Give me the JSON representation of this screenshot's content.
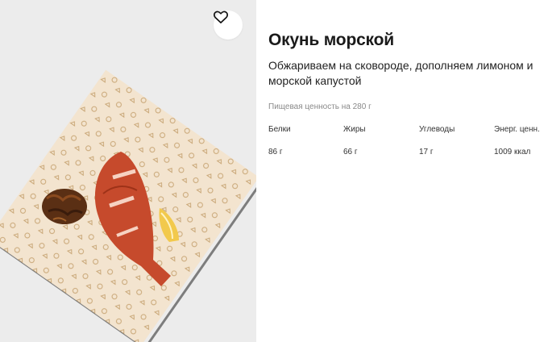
{
  "product": {
    "title": "Окунь морской",
    "description": "Обжариваем на сковороде, дополняем лимоном и морской капустой",
    "image_icon": "fish-dish-photo",
    "favorite_icon": "heart-outline-icon"
  },
  "nutrition": {
    "caption": "Пищевая ценность на 280 г",
    "items": [
      {
        "label": "Белки",
        "value": "86 г"
      },
      {
        "label": "Жиры",
        "value": "66 г"
      },
      {
        "label": "Углеводы",
        "value": "17 г"
      },
      {
        "label": "Энерг. ценн.",
        "value": "1009 ккал"
      }
    ]
  },
  "colors": {
    "photo_background": "#ececec",
    "paper": "#f3e4cf",
    "fish": "#c64a2c",
    "lemon": "#f2c94c"
  }
}
